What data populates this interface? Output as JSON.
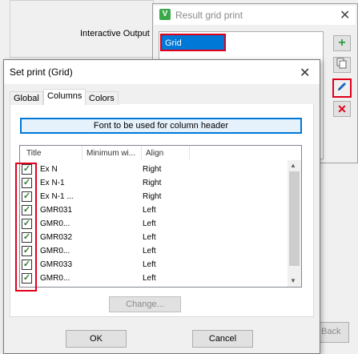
{
  "background_window": {
    "interactive_output_label": "Interactive Output",
    "back_button_label": "Back"
  },
  "result_grid_window": {
    "title": "Result grid print",
    "logo_glyph": "V",
    "close_glyph": "✕",
    "items": [
      "Grid"
    ],
    "buttons": {
      "add_icon": "plus-icon",
      "copy_icon": "copy-icon",
      "edit_icon": "pencil-icon",
      "delete_icon": "x-icon"
    }
  },
  "dialog": {
    "title": "Set print (Grid)",
    "close_glyph": "✕",
    "tabs": [
      {
        "label": "Global",
        "active": false
      },
      {
        "label": "Columns",
        "active": true
      },
      {
        "label": "Colors",
        "active": false
      }
    ],
    "font_header_button": "Font to be used for column header",
    "columns_grid": {
      "headers": [
        "Title",
        "Minimum wi...",
        "Align"
      ],
      "rows": [
        {
          "checked": true,
          "title": "Ex N",
          "align": "Right"
        },
        {
          "checked": true,
          "title": "Ex N-1",
          "align": "Right"
        },
        {
          "checked": true,
          "title": "Ex N-1 ...",
          "align": "Right"
        },
        {
          "checked": true,
          "title": "GMR031",
          "align": "Left"
        },
        {
          "checked": true,
          "title": "GMR0...",
          "align": "Left"
        },
        {
          "checked": true,
          "title": "GMR032",
          "align": "Left"
        },
        {
          "checked": true,
          "title": "GMR0...",
          "align": "Left"
        },
        {
          "checked": true,
          "title": "GMR033",
          "align": "Left"
        },
        {
          "checked": true,
          "title": "GMR0...",
          "align": "Left"
        }
      ],
      "check_glyph": "✓",
      "scroll_up_glyph": "▲",
      "scroll_down_glyph": "▼"
    },
    "change_button": "Change...",
    "ok_button": "OK",
    "cancel_button": "Cancel"
  },
  "colors": {
    "highlight_red": "#e0001b",
    "selection_blue": "#0078d7",
    "check_green": "#2e7d32"
  }
}
